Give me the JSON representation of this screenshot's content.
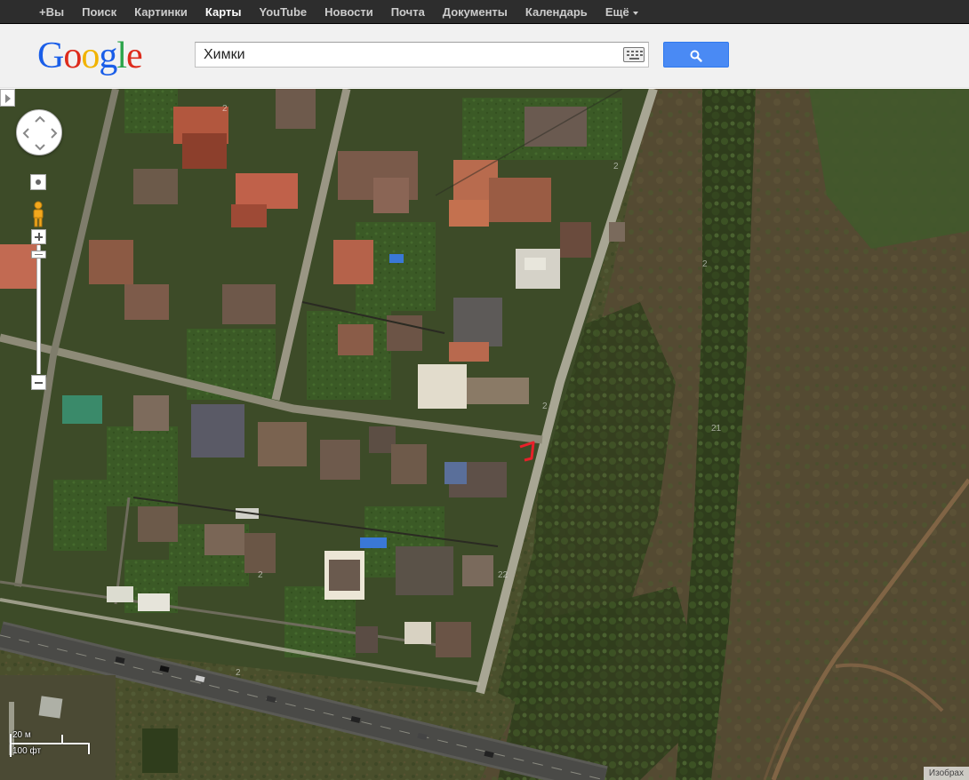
{
  "nav": {
    "items": [
      {
        "label": "+Вы",
        "active": false
      },
      {
        "label": "Поиск",
        "active": false
      },
      {
        "label": "Картинки",
        "active": false
      },
      {
        "label": "Карты",
        "active": true
      },
      {
        "label": "YouTube",
        "active": false
      },
      {
        "label": "Новости",
        "active": false
      },
      {
        "label": "Почта",
        "active": false
      },
      {
        "label": "Документы",
        "active": false
      },
      {
        "label": "Календарь",
        "active": false
      },
      {
        "label": "Ещё",
        "active": false
      }
    ]
  },
  "header": {
    "logo_text": "Google",
    "search_value": "Химки",
    "keyboard_icon": "keyboard-icon",
    "search_icon": "magnifier-icon",
    "accent": "#4a8af4"
  },
  "map": {
    "view": "satellite",
    "scale_metric": "20 м",
    "scale_imperial": "100 фт",
    "imagery_label": "Изобрах",
    "marker_color": "#e8202a"
  }
}
